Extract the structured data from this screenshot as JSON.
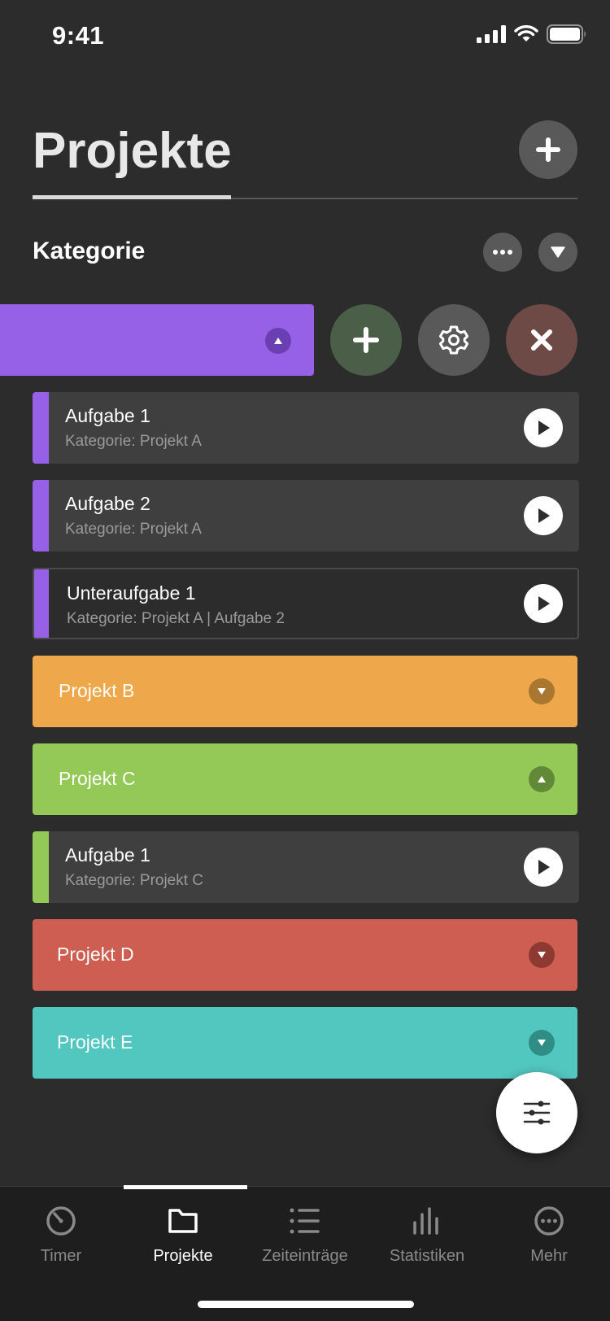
{
  "status_bar": {
    "time": "9:41"
  },
  "header": {
    "title": "Projekte"
  },
  "section": {
    "label": "Kategorie"
  },
  "colors": {
    "background": "#2c2c2c",
    "purple": "#9661e6",
    "orange": "#eea84b",
    "green": "#94c857",
    "red": "#cf5e52",
    "teal": "#52c7bf"
  },
  "tasks": [
    {
      "title": "Aufgabe 1",
      "subtitle": "Kategorie: Projekt A"
    },
    {
      "title": "Aufgabe 2",
      "subtitle": "Kategorie: Projekt A"
    },
    {
      "title": "Unteraufgabe 1",
      "subtitle": "Kategorie: Projekt A | Aufgabe 2"
    },
    {
      "title": "Aufgabe 1",
      "subtitle": "Kategorie: Projekt C"
    }
  ],
  "projects": [
    {
      "name": "Projekt B"
    },
    {
      "name": "Projekt C"
    },
    {
      "name": "Projekt D"
    },
    {
      "name": "Projekt E"
    }
  ],
  "tab_bar": {
    "tabs": [
      {
        "label": "Timer",
        "icon": "timer-icon"
      },
      {
        "label": "Projekte",
        "icon": "folder-icon"
      },
      {
        "label": "Zeiteinträge",
        "icon": "list-icon"
      },
      {
        "label": "Statistiken",
        "icon": "bar-chart-icon"
      },
      {
        "label": "Mehr",
        "icon": "more-circle-icon"
      }
    ],
    "active_index": 1
  }
}
